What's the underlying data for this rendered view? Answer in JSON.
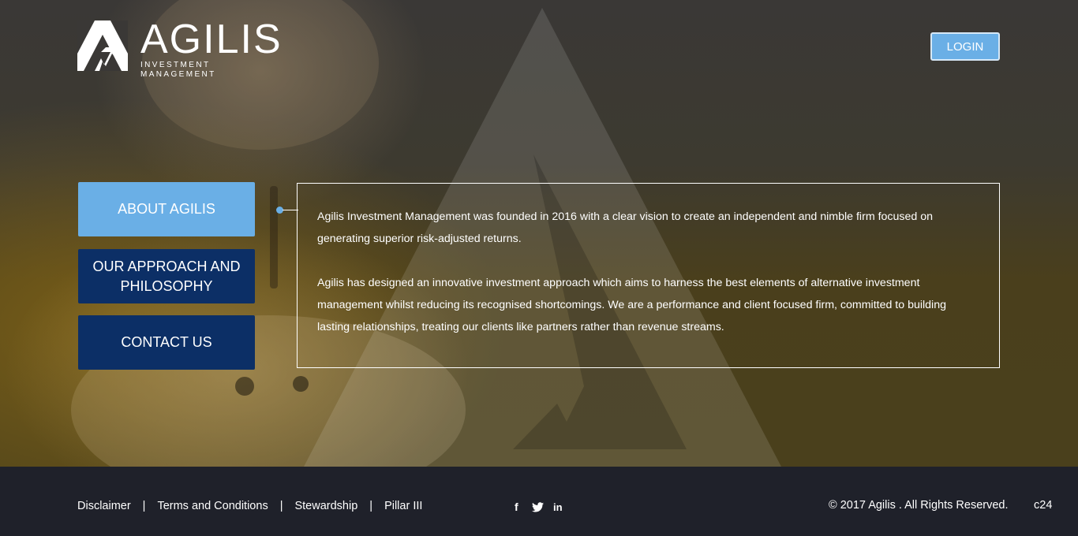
{
  "header": {
    "logo_text": "AGILIS",
    "logo_subtitle": "INVESTMENT MANAGEMENT",
    "login_label": "LOGIN"
  },
  "nav": {
    "items": [
      {
        "label": "ABOUT AGILIS",
        "active": true
      },
      {
        "label": "OUR APPROACH AND PHILOSOPHY",
        "active": false
      },
      {
        "label": "CONTACT US",
        "active": false
      }
    ]
  },
  "content": {
    "paragraphs": [
      "Agilis Investment Management was founded in 2016 with a clear vision to create an independent and nimble firm focused on generating superior risk-adjusted returns.",
      "Agilis has designed an innovative investment approach which aims to harness the best elements of alternative investment management whilst reducing its recognised shortcomings. We are a performance and client focused firm, committed to building lasting relationships, treating our clients like partners rather than revenue streams."
    ]
  },
  "footer": {
    "links": [
      {
        "label": "Disclaimer"
      },
      {
        "label": "Terms and Conditions"
      },
      {
        "label": "Stewardship"
      },
      {
        "label": "Pillar III"
      }
    ],
    "separator": "|",
    "social": [
      {
        "icon": "facebook-icon",
        "glyph": "f"
      },
      {
        "icon": "twitter-icon"
      },
      {
        "icon": "linkedin-icon",
        "glyph": "in"
      }
    ],
    "copyright": "© 2017 Agilis . All Rights Reserved.",
    "code": "c24"
  },
  "colors": {
    "accent": "#6aafe6",
    "nav_dark": "#0c2f66",
    "footer_bg": "#1f212a"
  }
}
